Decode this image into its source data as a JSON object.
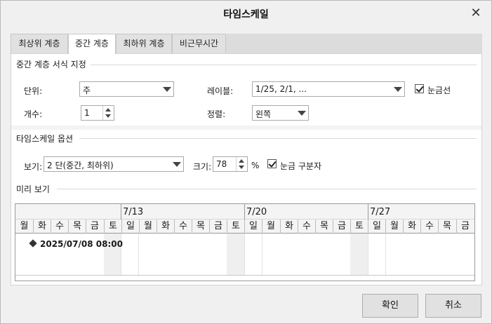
{
  "dialog": {
    "title": "타임스케일",
    "close_glyph": "✕"
  },
  "tabs": [
    "최상위 계층",
    "중간 계층",
    "최하위 계층",
    "비근무시간"
  ],
  "middle_tier": {
    "section_title": "중간 계층 서식 지정",
    "unit_label": "단위:",
    "unit_value": "주",
    "label_label": "레이블:",
    "label_value": "1/25, 2/1, ...",
    "tick_lines_label": "눈금선",
    "count_label": "개수:",
    "count_value": "1",
    "align_label": "정렬:",
    "align_value": "왼쪽"
  },
  "options": {
    "section_title": "타임스케일 옵션",
    "show_label": "보기:",
    "show_value": "2 단(중간, 최하위)",
    "size_label": "크기:",
    "size_value": "78",
    "percent": "%",
    "scale_separator_label": "눈금 구분자"
  },
  "preview": {
    "section_title": "미리 보기",
    "weeks": [
      "7/13",
      "7/20",
      "7/27"
    ],
    "days": [
      "월",
      "화",
      "수",
      "목",
      "금",
      "토",
      "일",
      "월",
      "화",
      "수",
      "목",
      "금",
      "토",
      "일",
      "월",
      "화",
      "수",
      "목",
      "금",
      "토",
      "일",
      "월",
      "화",
      "수",
      "목",
      "금"
    ],
    "milestone": "2025/07/08 08:00"
  },
  "buttons": {
    "ok": "확인",
    "cancel": "취소"
  }
}
